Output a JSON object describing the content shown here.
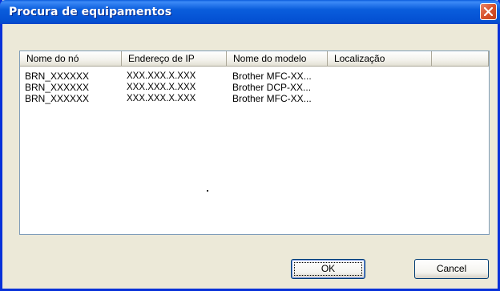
{
  "window": {
    "title": "Procura de equipamentos",
    "title_bar_color": "#0a5ddc",
    "close_icon": "close-icon"
  },
  "list": {
    "columns": [
      "Nome do nó",
      "Endereço de IP",
      "Nome do modelo",
      "Localização",
      ""
    ],
    "rows": [
      [
        "BRN_XXXXXX",
        "XXX.XXX.X.XXX",
        "Brother MFC-XX...",
        ""
      ],
      [
        "BRN_XXXXXX",
        "XXX.XXX.X.XXX",
        "Brother DCP-XX...",
        ""
      ],
      [
        "BRN_XXXXXX",
        "XXX.XXX.X.XXX",
        "Brother MFC-XX...",
        ""
      ]
    ]
  },
  "buttons": {
    "ok": "OK",
    "cancel": "Cancel"
  }
}
